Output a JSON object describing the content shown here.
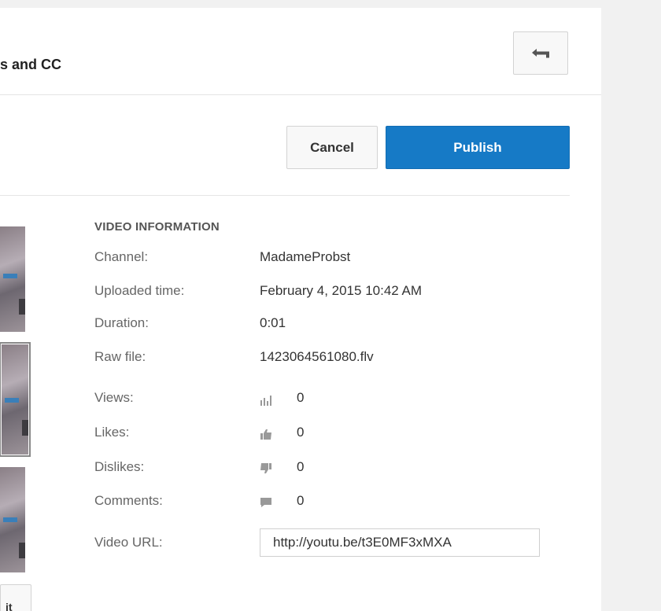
{
  "header": {
    "title": "es and CC"
  },
  "actions": {
    "cancel_label": "Cancel",
    "publish_label": "Publish"
  },
  "thumbnail": {
    "button_label": "it"
  },
  "video_info": {
    "heading": "VIDEO INFORMATION",
    "channel_label": "Channel:",
    "channel_value": "MadameProbst",
    "uploaded_label": "Uploaded time:",
    "uploaded_value": "February 4, 2015 10:42 AM",
    "duration_label": "Duration:",
    "duration_value": "0:01",
    "rawfile_label": "Raw file:",
    "rawfile_value": "1423064561080.flv",
    "views_label": "Views:",
    "views_value": "0",
    "likes_label": "Likes:",
    "likes_value": "0",
    "dislikes_label": "Dislikes:",
    "dislikes_value": "0",
    "comments_label": "Comments:",
    "comments_value": "0",
    "url_label": "Video URL:",
    "url_value": "http://youtu.be/t3E0MF3xMXA"
  },
  "icons": [
    "back-arrow-icon",
    "bar-chart-icon",
    "thumbs-up-icon",
    "thumbs-down-icon",
    "comment-icon"
  ],
  "colors": {
    "publish": "#167ac6",
    "background": "#f1f1f1",
    "panel": "#ffffff"
  }
}
